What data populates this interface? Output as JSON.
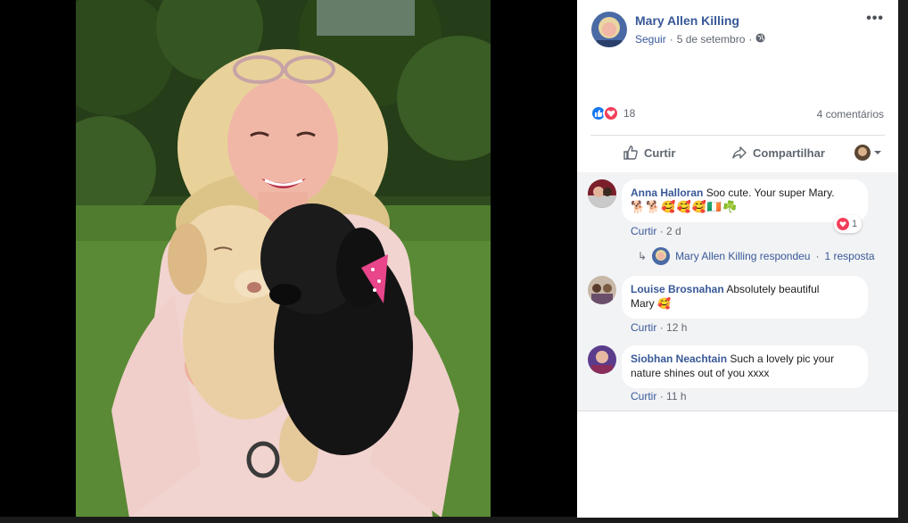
{
  "post": {
    "author": "Mary Allen Killing",
    "follow_label": "Seguir",
    "separator": "·",
    "date": "5 de setembro",
    "globe_icon": "globe-icon",
    "more_label": "•••"
  },
  "stats": {
    "reaction_count": "18",
    "comments_label": "4 comentários"
  },
  "actions": {
    "like_label": "Curtir",
    "share_label": "Compartilhar"
  },
  "comments": [
    {
      "name": "Anna Halloran",
      "text": "Soo cute. Your super Mary.",
      "emoji_line": "🐕🐕🥰🥰🥰🇮🇪☘️",
      "like_label": "Curtir",
      "sep": "·",
      "time": "2 d",
      "reaction_count": "1",
      "reply": {
        "author_action": "Mary Allen Killing respondeu",
        "sep": "·",
        "count": "1 resposta"
      }
    },
    {
      "name": "Louise Brosnahan",
      "text": "Absolutely beautiful",
      "text_line2": "Mary 🥰",
      "like_label": "Curtir",
      "sep": "·",
      "time": "12 h"
    },
    {
      "name": "Siobhan Neachtain",
      "text": "Such a lovely pic your",
      "text_line2": "nature shines out of you xxxx",
      "like_label": "Curtir",
      "sep": "·",
      "time": "11 h"
    }
  ],
  "colors": {
    "link": "#385898",
    "like_blue": "#1877f2",
    "love_red": "#f33e58",
    "comment_bg": "#f2f3f5"
  }
}
